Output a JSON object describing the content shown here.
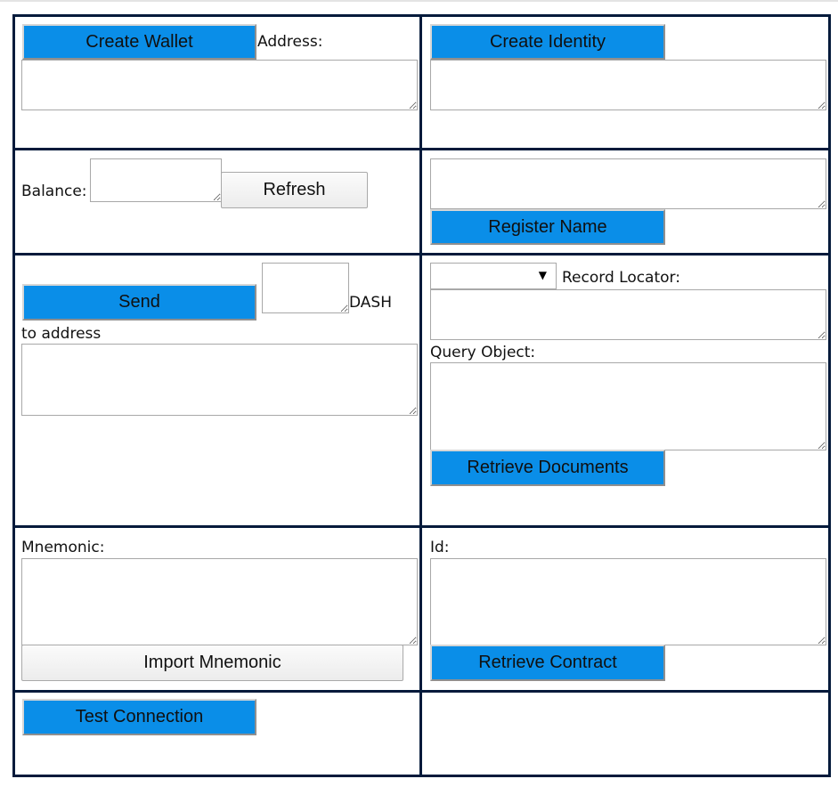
{
  "wallet": {
    "create_wallet_label": "Create Wallet",
    "address_label": "Address:",
    "address_value": ""
  },
  "identity": {
    "create_identity_label": "Create Identity",
    "identity_value": ""
  },
  "balance": {
    "balance_label": "Balance:",
    "balance_value": "",
    "refresh_label": "Refresh"
  },
  "name": {
    "name_value": "",
    "register_name_label": "Register Name"
  },
  "send": {
    "send_label": "Send",
    "amount_value": "",
    "currency_label": "DASH",
    "to_address_label": "to address",
    "to_address_value": ""
  },
  "documents": {
    "selected_option": "",
    "record_locator_label": "Record Locator:",
    "record_locator_value": "",
    "query_object_label": "Query Object:",
    "query_object_value": "",
    "retrieve_documents_label": "Retrieve Documents"
  },
  "mnemonic": {
    "mnemonic_label": "Mnemonic:",
    "mnemonic_value": "",
    "import_mnemonic_label": "Import Mnemonic"
  },
  "contract": {
    "id_label": "Id:",
    "id_value": "",
    "retrieve_contract_label": "Retrieve Contract"
  },
  "connection": {
    "test_connection_label": "Test Connection"
  },
  "colors": {
    "button_blue": "#0a8ee8",
    "cell_border": "#041a3b"
  },
  "icons": {
    "dropdown_caret": "triangle-down-icon",
    "textarea_resize": "resize-grip-icon"
  }
}
